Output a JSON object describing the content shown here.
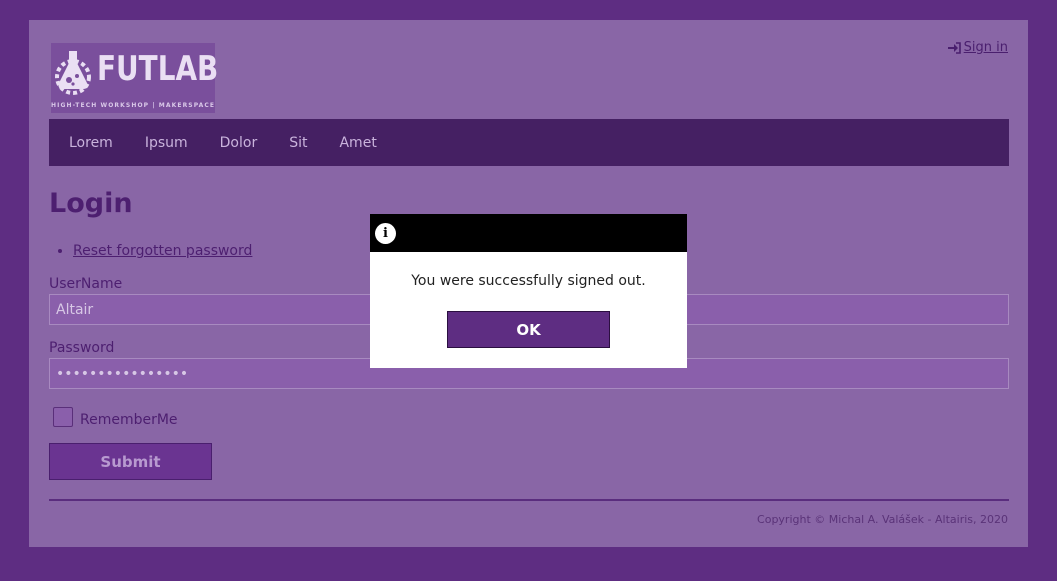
{
  "header": {
    "logo_text": "FUTLAB",
    "logo_tagline": "HIGH-TECH WORKSHOP | MAKERSPACE",
    "signin_label": "Sign in"
  },
  "nav": {
    "items": [
      "Lorem",
      "Ipsum",
      "Dolor",
      "Sit",
      "Amet"
    ]
  },
  "login": {
    "title": "Login",
    "reset_link": "Reset forgotten password",
    "username_label": "UserName",
    "username_value": "Altair",
    "password_label": "Password",
    "password_value": "••••••••••••••••",
    "remember_label": "RememberMe",
    "submit_label": "Submit"
  },
  "footer": {
    "copyright": "Copyright © Michal A. Valášek - Altairis, 2020"
  },
  "modal": {
    "icon": "info-icon",
    "message": "You were successfully signed out.",
    "ok_label": "OK"
  },
  "colors": {
    "outer_bg": "#5e2d82",
    "page_bg": "#8966a6",
    "nav_bg": "#452063",
    "modal_header": "#000000",
    "primary_button": "#5e2d82"
  }
}
